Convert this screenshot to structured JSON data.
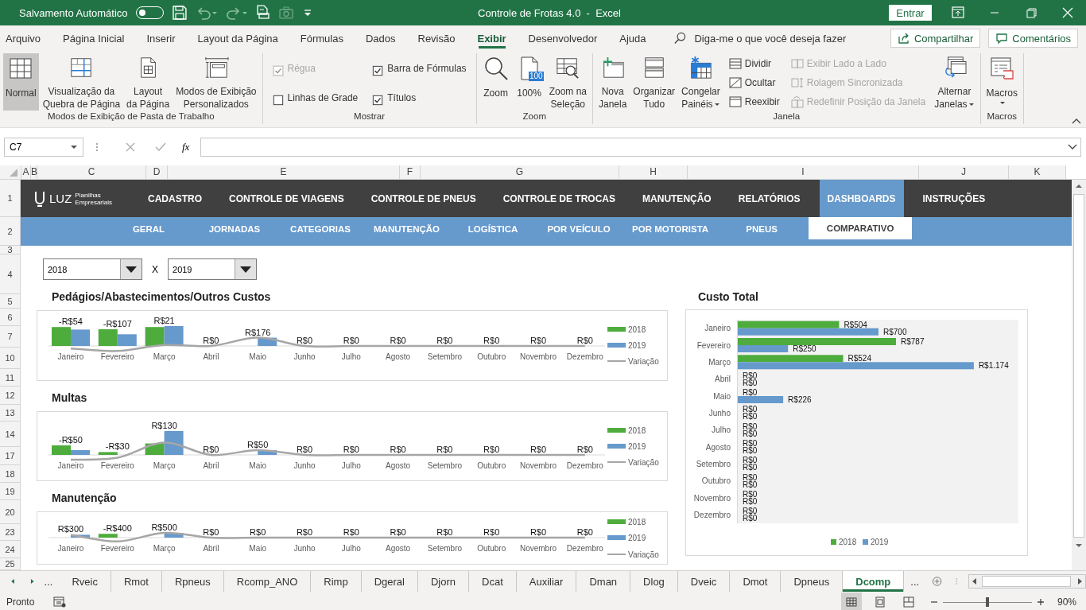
{
  "title_bar": {
    "autosave_label": "Salvamento Automático",
    "autosave_on": false,
    "title": "Controle de Frotas 4.0  -  Excel",
    "signin": "Entrar"
  },
  "menu_tabs": [
    {
      "label": "Arquivo",
      "selected": false
    },
    {
      "label": "Página Inicial",
      "selected": false
    },
    {
      "label": "Inserir",
      "selected": false
    },
    {
      "label": "Layout da Página",
      "selected": false
    },
    {
      "label": "Fórmulas",
      "selected": false
    },
    {
      "label": "Dados",
      "selected": false
    },
    {
      "label": "Revisão",
      "selected": false
    },
    {
      "label": "Exibir",
      "selected": true
    },
    {
      "label": "Desenvolvedor",
      "selected": false
    },
    {
      "label": "Ajuda",
      "selected": false
    }
  ],
  "tell_me": {
    "placeholder": "Diga-me o que você deseja fazer"
  },
  "share_button": {
    "label": "Compartilhar"
  },
  "comments_button": {
    "label": "Comentários"
  },
  "ribbon": {
    "groups": [
      {
        "label": "Modos de Exibição de Pasta de Trabalho",
        "items": [
          {
            "kind": "large",
            "lines": [
              "Normal"
            ],
            "selected": true
          },
          {
            "kind": "large",
            "lines": [
              "Visualização da",
              "Quebra de Página"
            ],
            "selected": false
          },
          {
            "kind": "large",
            "lines": [
              "Layout",
              "da Página"
            ],
            "selected": false
          },
          {
            "kind": "large",
            "lines": [
              "Modos de Exibição",
              "Personalizados"
            ],
            "selected": false
          }
        ]
      },
      {
        "label": "Mostrar",
        "items": [
          {
            "kind": "stack",
            "items": [
              {
                "kind": "check",
                "label": "Régua",
                "checked": true,
                "disabled": true
              },
              {
                "kind": "check",
                "label": "Linhas de Grade",
                "checked": false,
                "disabled": false
              }
            ]
          },
          {
            "kind": "stack",
            "items": [
              {
                "kind": "check",
                "label": "Barra de Fórmulas",
                "checked": true,
                "disabled": false
              },
              {
                "kind": "check",
                "label": "Títulos",
                "checked": true,
                "disabled": false
              }
            ]
          }
        ]
      },
      {
        "label": "Zoom",
        "items": [
          {
            "kind": "large",
            "lines": [
              "Zoom"
            ]
          },
          {
            "kind": "large",
            "lines": [
              "100%"
            ],
            "badge": "100"
          },
          {
            "kind": "large",
            "lines": [
              "Zoom na",
              "Seleção"
            ]
          }
        ]
      },
      {
        "label": "Janela",
        "items": [
          {
            "kind": "large",
            "lines": [
              "Nova",
              "Janela"
            ]
          },
          {
            "kind": "large",
            "lines": [
              "Organizar",
              "Tudo"
            ]
          },
          {
            "kind": "large",
            "lines": [
              "Congelar",
              "Painéis"
            ],
            "dropdown": true
          },
          {
            "kind": "stack",
            "items": [
              {
                "kind": "small",
                "label": "Dividir",
                "disabled": false
              },
              {
                "kind": "small",
                "label": "Ocultar",
                "disabled": false
              },
              {
                "kind": "small",
                "label": "Reexibir",
                "disabled": false
              }
            ]
          },
          {
            "kind": "stack",
            "items": [
              {
                "kind": "small",
                "label": "Exibir Lado a Lado",
                "disabled": true
              },
              {
                "kind": "small",
                "label": "Rolagem Sincronizada",
                "disabled": true
              },
              {
                "kind": "small",
                "label": "Redefinir Posição da Janela",
                "disabled": true
              }
            ]
          },
          {
            "kind": "large",
            "lines": [
              "Alternar",
              "Janelas"
            ],
            "dropdown": true
          }
        ]
      },
      {
        "label": "Macros",
        "items": [
          {
            "kind": "large",
            "lines": [
              "Macros"
            ],
            "dropdown": true
          }
        ]
      }
    ]
  },
  "formula_bar": {
    "name_box": "C7",
    "fx_label": "fx"
  },
  "columns": [
    "A",
    "B",
    "C",
    "D",
    "E",
    "F",
    "G",
    "H",
    "I",
    "J",
    "K"
  ],
  "rows": [
    "1",
    "2",
    "3",
    "4",
    "5",
    "6",
    "7",
    "10",
    "11",
    "12",
    "13",
    "14",
    "17",
    "18",
    "19",
    "20",
    "23",
    "24",
    "25"
  ],
  "dashboard": {
    "logo": {
      "name": "LUZ",
      "tagline": [
        "Planilhas",
        "Empresariais"
      ]
    },
    "nav": [
      {
        "label": "CADASTRO",
        "selected": false
      },
      {
        "label": "CONTROLE DE VIAGENS",
        "selected": false
      },
      {
        "label": "CONTROLE DE PNEUS",
        "selected": false
      },
      {
        "label": "CONTROLE DE TROCAS",
        "selected": false
      },
      {
        "label": "MANUTENÇÃO",
        "selected": false
      },
      {
        "label": "RELATÓRIOS",
        "selected": false
      },
      {
        "label": "DASHBOARDS",
        "selected": true
      },
      {
        "label": "INSTRUÇÕES",
        "selected": false
      }
    ],
    "subnav": [
      {
        "label": "GERAL",
        "selected": false
      },
      {
        "label": "JORNADAS",
        "selected": false
      },
      {
        "label": "CATEGORIAS",
        "selected": false
      },
      {
        "label": "MANUTENÇÃO",
        "selected": false
      },
      {
        "label": "LOGÍSTICA",
        "selected": false
      },
      {
        "label": "POR VEÍCULO",
        "selected": false
      },
      {
        "label": "POR MOTORISTA",
        "selected": false
      },
      {
        "label": "PNEUS",
        "selected": false
      },
      {
        "label": "COMPARATIVO",
        "selected": true
      }
    ],
    "year_selectors": {
      "first": "2018",
      "separator": "X",
      "second": "2019"
    },
    "charts": [
      {
        "title": "Pedágios/Abastecimentos/Outros Custos",
        "chart_data": {
          "type": "bar",
          "stacked": false,
          "legend": "right",
          "categories": [
            "Janeiro",
            "Fevereiro",
            "Março",
            "Abril",
            "Maio",
            "Junho",
            "Julho",
            "Agosto",
            "Setembro",
            "Outubro",
            "Novembro",
            "Dezembro"
          ],
          "series": [
            {
              "name": "2018",
              "type": "bar",
              "color": "#4eac3c",
              "values": [
                404,
                357,
                404,
                0,
                0,
                0,
                0,
                0,
                0,
                0,
                0,
                0
              ]
            },
            {
              "name": "2019",
              "type": "bar",
              "color": "#6699cc",
              "values": [
                350,
                250,
                424,
                0,
                176,
                0,
                0,
                0,
                0,
                0,
                0,
                0
              ]
            },
            {
              "name": "Variação",
              "type": "line",
              "color": "#a6a6a6",
              "values": [
                -54,
                -107,
                21,
                0,
                176,
                0,
                0,
                0,
                0,
                0,
                0,
                0
              ],
              "value_labels": [
                "-R$54",
                "-R$107",
                "R$21",
                "R$0",
                "R$176",
                "R$0",
                "R$0",
                "R$0",
                "R$0",
                "R$0",
                "R$0",
                "R$0"
              ]
            }
          ]
        }
      },
      {
        "title": "Multas",
        "chart_data": {
          "type": "bar",
          "stacked": false,
          "legend": "right",
          "categories": [
            "Janeiro",
            "Fevereiro",
            "Março",
            "Abril",
            "Maio",
            "Junho",
            "Julho",
            "Agosto",
            "Setembro",
            "Outubro",
            "Novembro",
            "Dezembro"
          ],
          "series": [
            {
              "name": "2018",
              "type": "bar",
              "color": "#4eac3c",
              "values": [
                100,
                30,
                120,
                0,
                0,
                0,
                0,
                0,
                0,
                0,
                0,
                0
              ]
            },
            {
              "name": "2019",
              "type": "bar",
              "color": "#6699cc",
              "values": [
                50,
                0,
                250,
                0,
                50,
                0,
                0,
                0,
                0,
                0,
                0,
                0
              ]
            },
            {
              "name": "Variação",
              "type": "line",
              "color": "#a6a6a6",
              "values": [
                -50,
                -30,
                130,
                0,
                50,
                0,
                0,
                0,
                0,
                0,
                0,
                0
              ],
              "value_labels": [
                "-R$50",
                "-R$30",
                "R$130",
                "R$0",
                "R$50",
                "R$0",
                "R$0",
                "R$0",
                "R$0",
                "R$0",
                "R$0",
                "R$0"
              ]
            }
          ]
        }
      },
      {
        "title": "Manutenção",
        "chart_data": {
          "type": "bar",
          "stacked": false,
          "legend": "right",
          "categories": [
            "Janeiro",
            "Fevereiro",
            "Março",
            "Abril",
            "Maio",
            "Junho",
            "Julho",
            "Agosto",
            "Setembro",
            "Outubro",
            "Novembro",
            "Dezembro"
          ],
          "series": [
            {
              "name": "2018",
              "type": "bar",
              "color": "#4eac3c",
              "values": [
                0,
                400,
                0,
                0,
                0,
                0,
                0,
                0,
                0,
                0,
                0,
                0
              ]
            },
            {
              "name": "2019",
              "type": "bar",
              "color": "#6699cc",
              "values": [
                300,
                0,
                500,
                0,
                0,
                0,
                0,
                0,
                0,
                0,
                0,
                0
              ]
            },
            {
              "name": "Variação",
              "type": "line",
              "color": "#a6a6a6",
              "values": [
                300,
                -400,
                500,
                0,
                0,
                0,
                0,
                0,
                0,
                0,
                0,
                0
              ],
              "value_labels": [
                "R$300",
                "-R$400",
                "R$500",
                "R$0",
                "R$0",
                "R$0",
                "R$0",
                "R$0",
                "R$0",
                "R$0",
                "R$0",
                "R$0"
              ]
            }
          ]
        }
      }
    ],
    "total_chart": {
      "title": "Custo Total",
      "chart_data": {
        "type": "bar",
        "orientation": "horizontal",
        "stacked": false,
        "legend": "bottom",
        "categories": [
          "Janeiro",
          "Fevereiro",
          "Março",
          "Abril",
          "Maio",
          "Junho",
          "Julho",
          "Agosto",
          "Setembro",
          "Outubro",
          "Novembro",
          "Dezembro"
        ],
        "series": [
          {
            "name": "2018",
            "color": "#4eac3c",
            "values": [
              504,
              787,
              524,
              0,
              0,
              0,
              0,
              0,
              0,
              0,
              0,
              0
            ],
            "value_labels": [
              "R$504",
              "R$787",
              "R$524",
              "R$0",
              "R$0",
              "R$0",
              "R$0",
              "R$0",
              "R$0",
              "R$0",
              "R$0",
              "R$0"
            ]
          },
          {
            "name": "2019",
            "color": "#6699cc",
            "values": [
              700,
              250,
              1174,
              0,
              226,
              0,
              0,
              0,
              0,
              0,
              0,
              0
            ],
            "value_labels": [
              "R$700",
              "R$250",
              "R$1.174",
              "R$0",
              "R$226",
              "R$0",
              "R$0",
              "R$0",
              "R$0",
              "R$0",
              "R$0",
              "R$0"
            ]
          }
        ]
      }
    }
  },
  "sheet_tabs_bar": {
    "more_left": "...",
    "tabs": [
      {
        "label": "Rveic",
        "selected": false
      },
      {
        "label": "Rmot",
        "selected": false
      },
      {
        "label": "Rpneus",
        "selected": false
      },
      {
        "label": "Rcomp_ANO",
        "selected": false
      },
      {
        "label": "Rimp",
        "selected": false
      },
      {
        "label": "Dgeral",
        "selected": false
      },
      {
        "label": "Djorn",
        "selected": false
      },
      {
        "label": "Dcat",
        "selected": false
      },
      {
        "label": "Auxiliar",
        "selected": false
      },
      {
        "label": "Dman",
        "selected": false
      },
      {
        "label": "Dlog",
        "selected": false
      },
      {
        "label": "Dveic",
        "selected": false
      },
      {
        "label": "Dmot",
        "selected": false
      },
      {
        "label": "Dpneus",
        "selected": false
      },
      {
        "label": "Dcomp",
        "selected": true
      }
    ],
    "more_right": "..."
  },
  "status_bar": {
    "status": "Pronto",
    "view_buttons": [
      {
        "selected": true
      },
      {
        "selected": false
      },
      {
        "selected": false
      }
    ],
    "zoom": {
      "level": 0.5,
      "label": "90%"
    }
  }
}
